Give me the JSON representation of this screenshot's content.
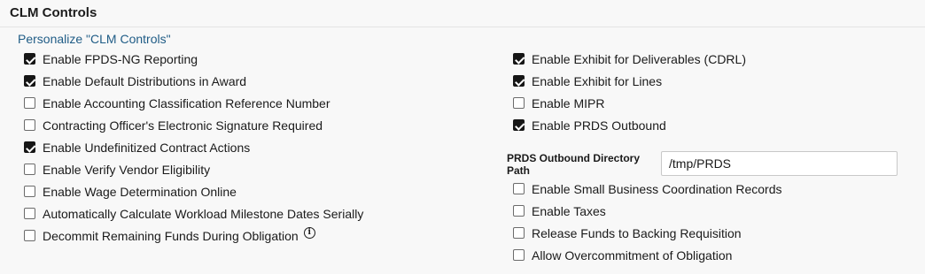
{
  "page": {
    "title": "CLM Controls",
    "personalize_link": "Personalize \"CLM Controls\""
  },
  "left_checkboxes": [
    {
      "label": "Enable FPDS-NG Reporting",
      "checked": true
    },
    {
      "label": "Enable Default Distributions in Award",
      "checked": true
    },
    {
      "label": "Enable Accounting Classification Reference Number",
      "checked": false
    },
    {
      "label": "Contracting Officer's Electronic Signature Required",
      "checked": false
    },
    {
      "label": "Enable Undefinitized Contract Actions",
      "checked": true
    },
    {
      "label": "Enable Verify Vendor Eligibility",
      "checked": false
    },
    {
      "label": "Enable Wage Determination Online",
      "checked": false
    },
    {
      "label": "Automatically Calculate Workload Milestone Dates Serially",
      "checked": false
    },
    {
      "label": "Decommit Remaining Funds During Obligation",
      "checked": false,
      "info_icon": "info-circle-icon"
    }
  ],
  "right_checkboxes_top": [
    {
      "label": "Enable Exhibit for Deliverables (CDRL)",
      "checked": true
    },
    {
      "label": "Enable Exhibit for Lines",
      "checked": true
    },
    {
      "label": "Enable MIPR",
      "checked": false
    },
    {
      "label": "Enable PRDS Outbound",
      "checked": true
    }
  ],
  "prds_path": {
    "label": "PRDS Outbound Directory Path",
    "value": "/tmp/PRDS"
  },
  "right_checkboxes_bottom": [
    {
      "label": "Enable Small Business Coordination Records",
      "checked": false
    },
    {
      "label": "Enable Taxes",
      "checked": false
    },
    {
      "label": "Release Funds to Backing Requisition",
      "checked": false
    },
    {
      "label": "Allow Overcommitment of Obligation",
      "checked": false
    }
  ],
  "colors": {
    "link": "#1f5c86",
    "checked_fill": "#161616",
    "background": "#f8f8f8"
  }
}
